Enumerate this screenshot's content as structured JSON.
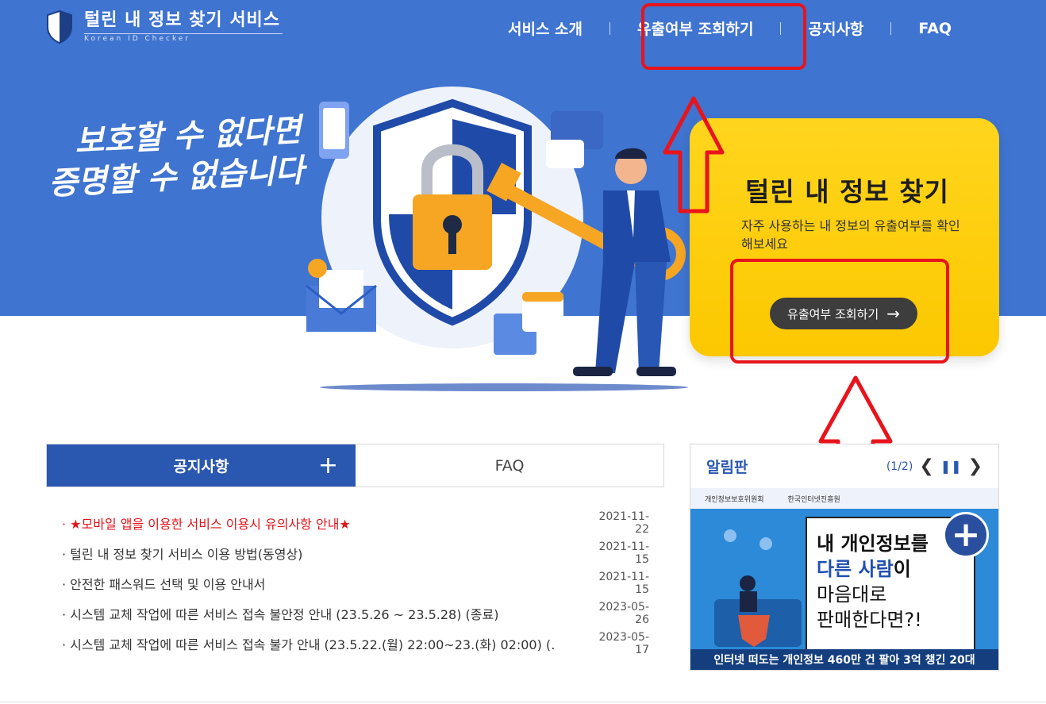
{
  "header": {
    "logo_title": "털린 내 정보 찾기 서비스",
    "logo_subtitle": "Korean ID Checker",
    "nav": [
      "서비스 소개",
      "유출여부 조회하기",
      "공지사항",
      "FAQ"
    ]
  },
  "hero": {
    "slogan_line1": "보호할 수 없다면",
    "slogan_line2": "증명할 수 없습니다"
  },
  "card": {
    "title": "털린 내 정보 찾기",
    "description": "자주 사용하는 내 정보의 유출여부를 확인해보세요",
    "button_label": "유출여부 조회하기",
    "button_arrow": "→"
  },
  "notice_tabs": {
    "notice_label": "공지사항",
    "notice_more": "+",
    "faq_label": "FAQ"
  },
  "notices": [
    {
      "title": "· ★모바일 앱을 이용한 서비스 이용시 유의사항 안내★",
      "date": "2021-11-22",
      "highlight": true
    },
    {
      "title": "· 털린 내 정보 찾기 서비스 이용 방법(동영상)",
      "date": "2021-11-15",
      "highlight": false
    },
    {
      "title": "· 안전한 패스워드 선택 및 이용 안내서",
      "date": "2021-11-15",
      "highlight": false
    },
    {
      "title": "· 시스템 교체 작업에 따른 서비스 접속 불안정 안내 (23.5.26 ~ 23.5.28) (종료)",
      "date": "2023-05-26",
      "highlight": false
    },
    {
      "title": "· 시스템 교체 작업에 따른 서비스 접속 불가 안내 (23.5.22.(월) 22:00~23.(화) 02:00) (…",
      "date": "2023-05-17",
      "highlight": false
    }
  ],
  "board": {
    "title": "알림판",
    "page": "(1/2)",
    "prev": "❮",
    "pause": "❚❚",
    "next": "❯",
    "banner_org1": "개인정보보호위원회",
    "banner_org2": "한국인터넷진흥원",
    "banner_line1_a": "내 ",
    "banner_line1_b": "개인정보",
    "banner_line1_c": "를",
    "banner_line2_a": "다른 사람",
    "banner_line2_b": "이",
    "banner_line3": "마음대로",
    "banner_line4": "판매한다면?!",
    "banner_plus": "+",
    "banner_bottom": "인터넷 떠도는 개인정보 460만 건 팔아 3억 챙긴 20대"
  },
  "colors": {
    "hero_blue": "#3f74d0",
    "card_yellow": "#ffd51d",
    "tab_blue": "#2a57b0",
    "annotation_red": "#e8141c"
  }
}
